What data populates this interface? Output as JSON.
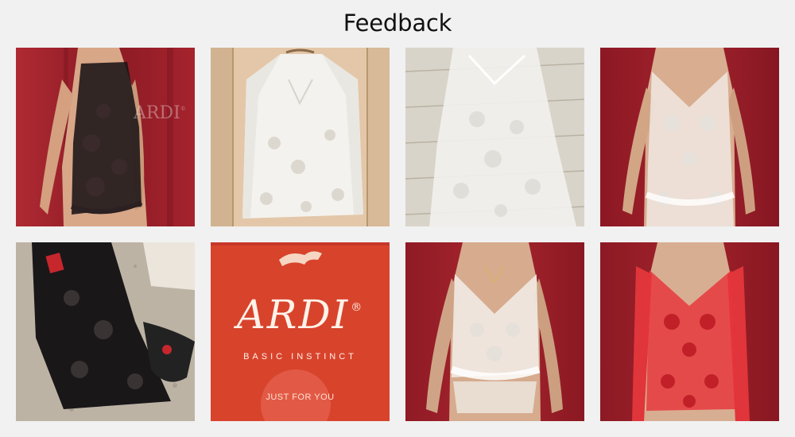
{
  "page": {
    "title": "Feedback"
  },
  "brand_box": {
    "brand": "ARDI",
    "registered": "®",
    "tagline": "BASIC INSTINCT",
    "sticker": "JUST FOR YOU"
  },
  "photos": [
    {
      "icon": "woman-black-lace-chemise-photo"
    },
    {
      "icon": "white-lace-robe-on-hanger-photo"
    },
    {
      "icon": "white-lace-chemise-on-floor-photo"
    },
    {
      "icon": "woman-white-lace-chemise-photo"
    },
    {
      "icon": "black-lace-set-on-carpet-photo"
    },
    {
      "icon": "ardi-box-photo"
    },
    {
      "icon": "woman-white-lace-camisole-set-photo"
    },
    {
      "icon": "woman-red-lace-set-photo"
    }
  ],
  "colors": {
    "background": "#f1f1f1",
    "curtain_red": "#8e1c26",
    "box_orange": "#d8432c"
  }
}
